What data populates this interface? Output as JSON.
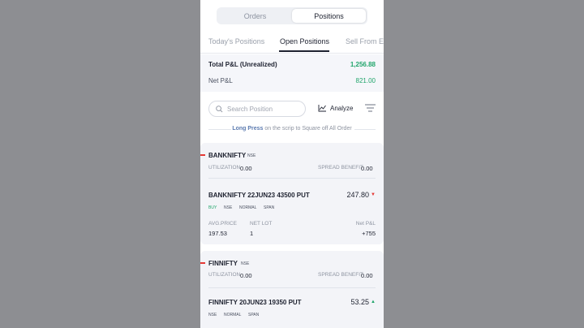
{
  "segment": {
    "orders": "Orders",
    "positions": "Positions"
  },
  "tabs": [
    "Today's Positions",
    "Open Positions",
    "Sell From Ex"
  ],
  "pnl": {
    "total_label": "Total P&L (Unrealized)",
    "total_value": "1,256.88",
    "net_label": "Net P&L",
    "net_value": "821.00"
  },
  "search": {
    "placeholder": "Search Position"
  },
  "analyze_label": "Analyze",
  "hint": {
    "bold": "Long Press",
    "rest": "on the scrip to Square off All Order"
  },
  "colors": {
    "profit": "#21a56b",
    "loss": "#e53935",
    "accent": "#5c7bb0"
  },
  "icons": {
    "search": "search-icon",
    "analyze": "chart-line-icon",
    "filter": "filter-icon"
  },
  "cards": [
    {
      "symbol": "BANKNIFTY",
      "exchange": "NSE",
      "utilization_label": "UTILIZATION",
      "utilization_value": "0.00",
      "spread_label": "SPREAD BENEFIT",
      "spread_value": "0.00",
      "contract": "BANKNIFTY 22JUN23 43500 PUT",
      "price": "247.80",
      "direction": "down",
      "tags": [
        "BUY",
        "NSE",
        "NORMAL",
        "SPAN"
      ],
      "avg_label": "AVG.PRICE",
      "avg_value": "197.53",
      "lot_label": "NET LOT",
      "lot_value": "1",
      "netpl_label": "Net P&L",
      "netpl_value": "+755"
    },
    {
      "symbol": "FINNIFTY",
      "exchange": "NSE",
      "utilization_label": "UTILIZATION",
      "utilization_value": "0.00",
      "spread_label": "SPREAD BENEFIT",
      "spread_value": "0.00",
      "contract": "FINNIFTY 20JUN23 19350 PUT",
      "price": "53.25",
      "direction": "up",
      "tags": [
        "NSE",
        "NORMAL",
        "SPAN"
      ]
    }
  ]
}
